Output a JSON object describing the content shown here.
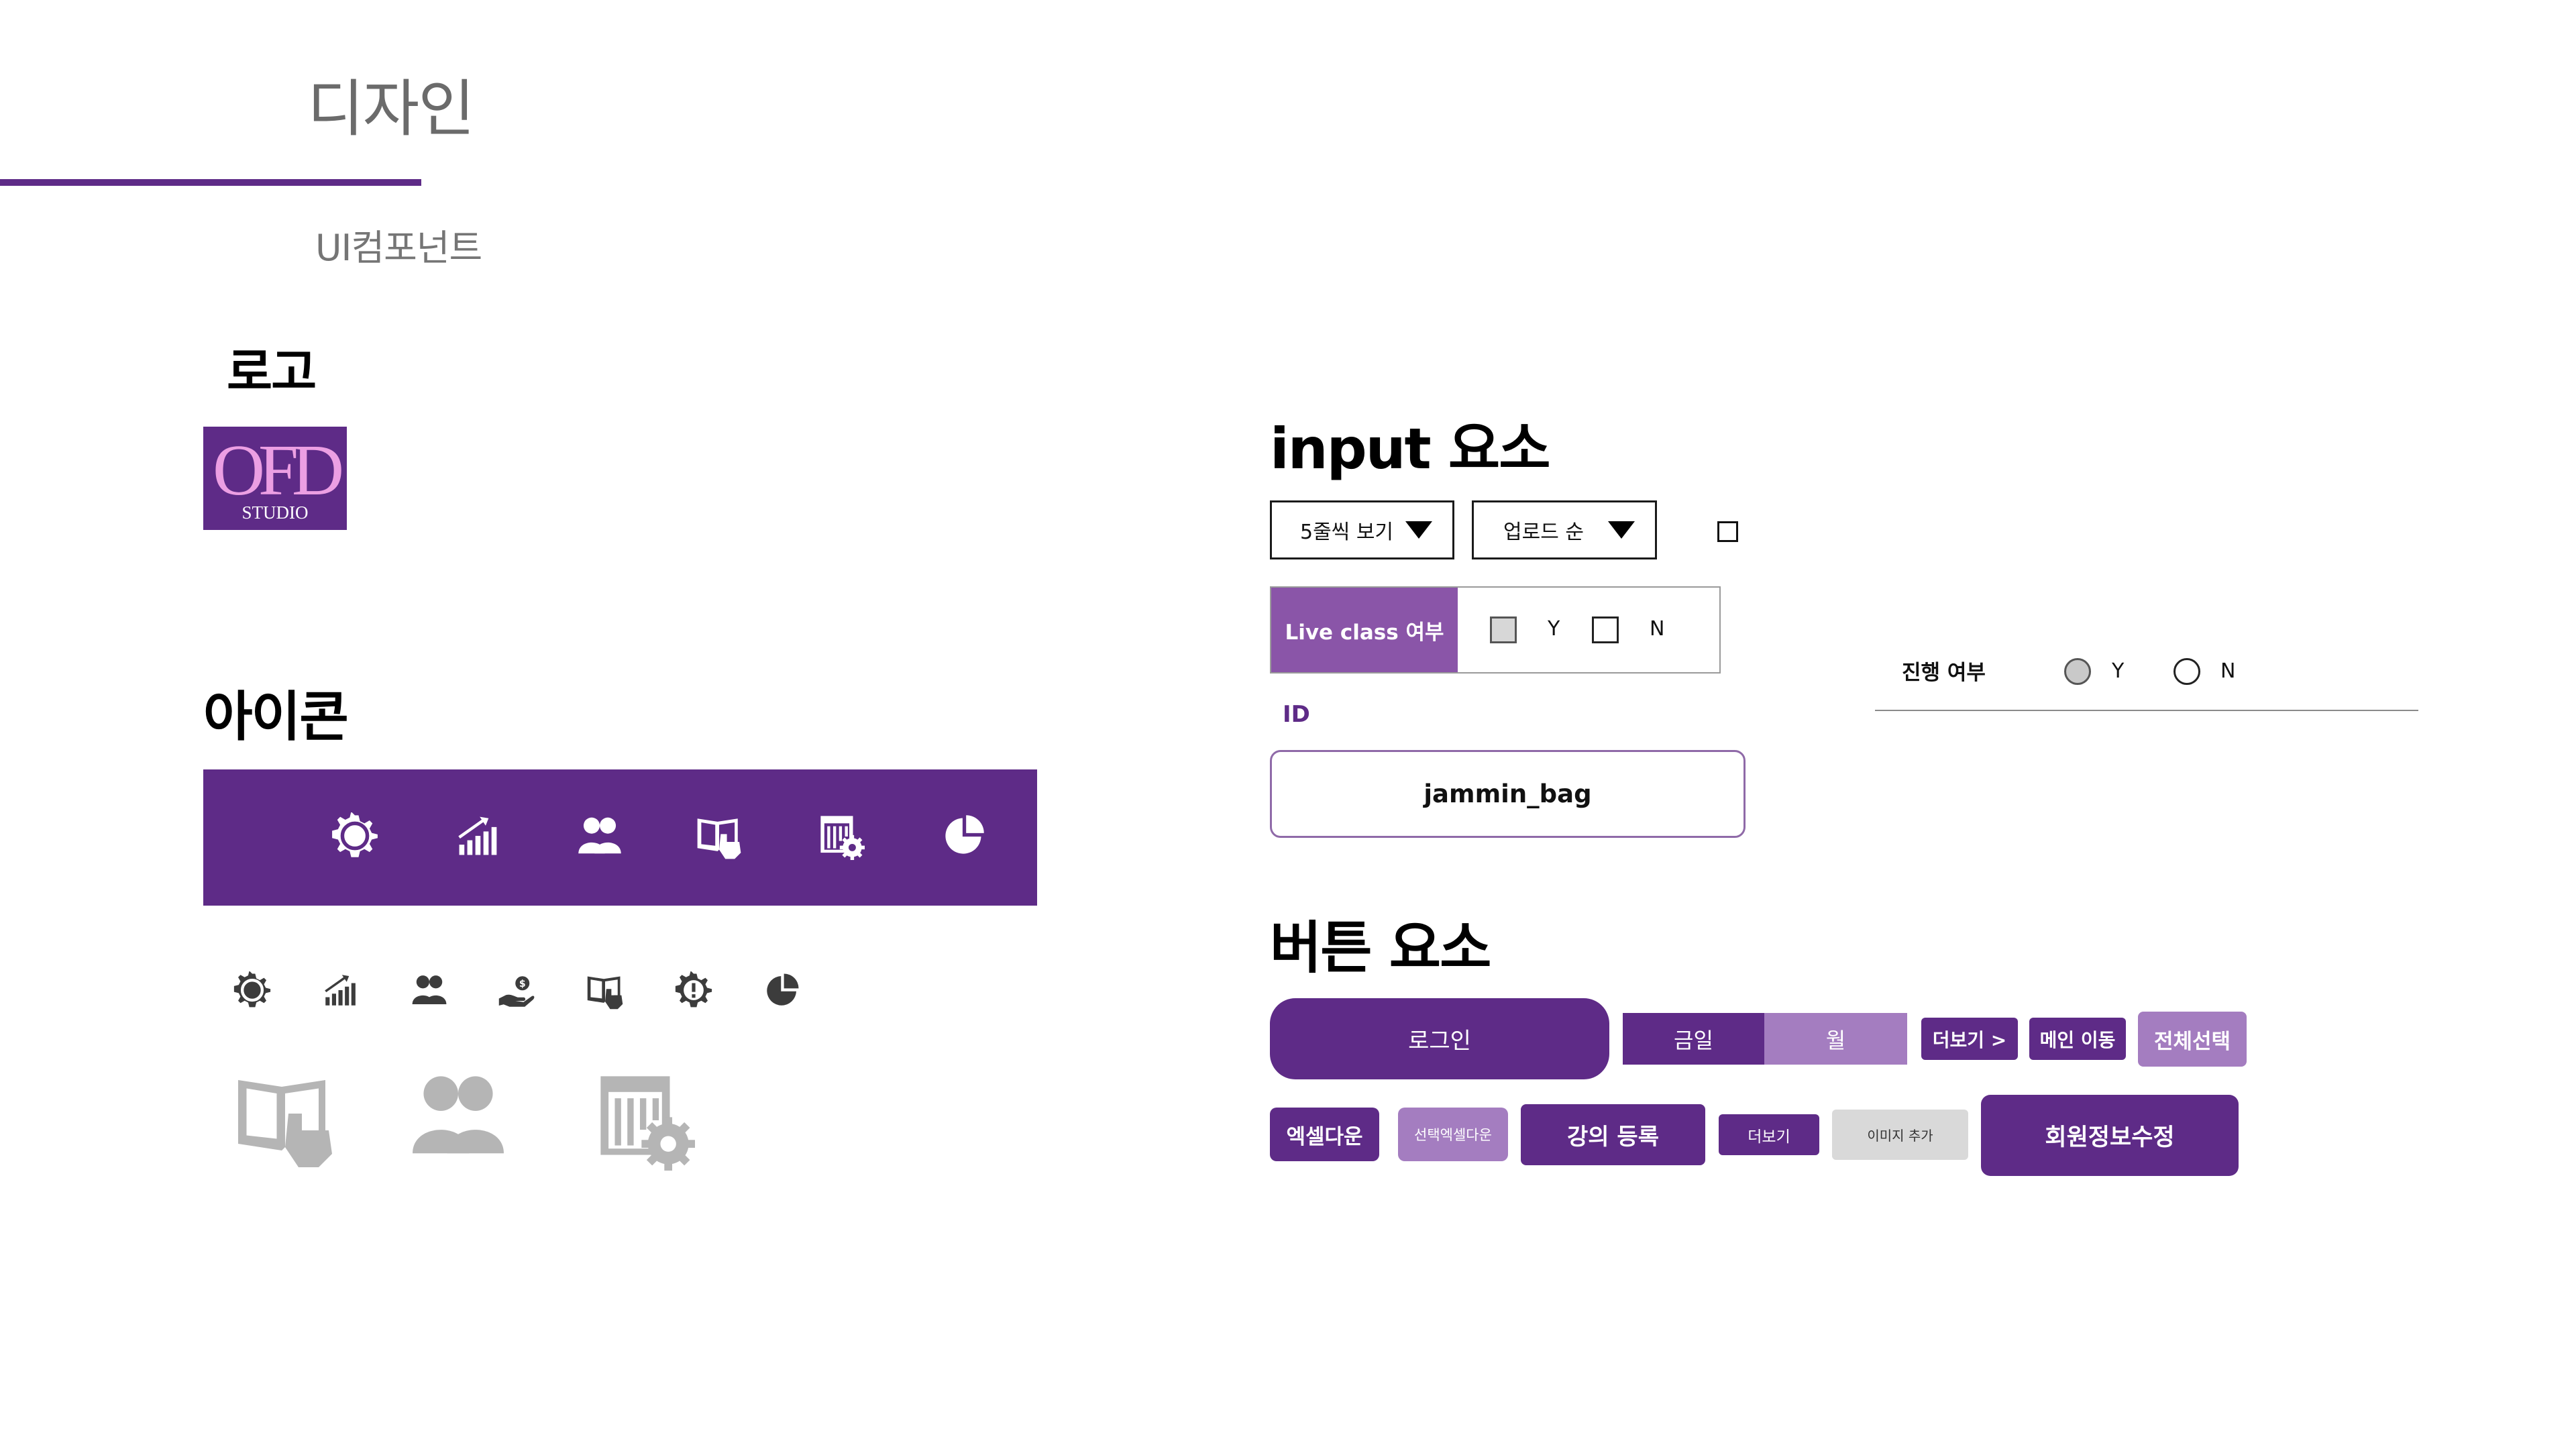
{
  "page": {
    "title": "디자인",
    "subtitle": "UI컴포넌트",
    "accent_color": "#5e2b87",
    "accent_light_color": "#a47dc0"
  },
  "logo": {
    "heading": "로고",
    "mark_text": "OFD",
    "sub_text": "STUDIO",
    "background_color": "#5e2b87",
    "mark_color": "#ec9fe3"
  },
  "icons": {
    "heading": "아이콘",
    "bar_icons": [
      "gear-icon",
      "growth-chart-icon",
      "users-icon",
      "lecture-book-icon",
      "schedule-settings-icon",
      "pie-chart-icon"
    ],
    "small_icons": [
      "gear-icon",
      "growth-chart-icon",
      "users-icon",
      "coin-hand-icon",
      "lecture-book-icon",
      "alert-gear-icon",
      "pie-chart-icon"
    ],
    "large_icons": [
      "lecture-book-icon",
      "users-icon",
      "schedule-settings-icon"
    ]
  },
  "inputs": {
    "heading": "input 요소",
    "select_rows": {
      "value": "5줄씩 보기"
    },
    "select_sort": {
      "value": "업로드 순"
    },
    "live_class": {
      "label": "Live class 여부",
      "option_y": "Y",
      "option_n": "N",
      "y_checked": true,
      "n_checked": false
    },
    "progress": {
      "label": "진행 여부",
      "option_y": "Y",
      "option_n": "N",
      "selected": "Y"
    },
    "id_field": {
      "label": "ID",
      "value": "jammin_bag"
    }
  },
  "buttons": {
    "heading": "버튼 요소",
    "login": "로그인",
    "segment_today": "금일",
    "segment_month": "월",
    "more_arrow": "더보기 >",
    "main_move": "메인 이동",
    "select_all": "전체선택",
    "excel_down": "엑셀다운",
    "selected_excel_down": "선택엑셀다운",
    "lecture_register": "강의 등록",
    "more": "더보기",
    "add_image": "이미지 추가",
    "edit_member": "회원정보수정"
  }
}
